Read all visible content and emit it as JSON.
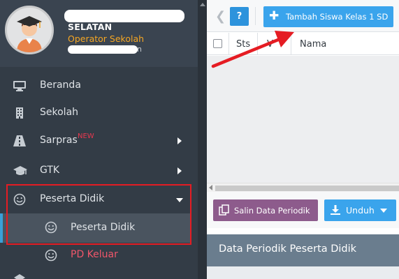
{
  "sidebar": {
    "user": {
      "school": "SELATAN",
      "role": "Operator Sekolah",
      "suffix": "n"
    },
    "menu": [
      {
        "label": "Beranda",
        "icon": "monitor-icon"
      },
      {
        "label": "Sekolah",
        "icon": "building-icon"
      },
      {
        "label": "Sarpras",
        "badge": "NEW",
        "icon": "road-icon"
      },
      {
        "label": "GTK",
        "icon": "graduation-cap-icon"
      },
      {
        "label": "Peserta Didik",
        "icon": "smile-icon"
      }
    ],
    "submenu": [
      {
        "label": "Peserta Didik",
        "icon": "smile-icon"
      },
      {
        "label": "PD Keluar",
        "icon": "smile-icon"
      }
    ]
  },
  "toolbar": {
    "help_label": "?",
    "add_label": "Tambah Siswa Kelas 1 SD"
  },
  "grid": {
    "columns": [
      "Sts",
      "V",
      "Nama"
    ]
  },
  "actions": {
    "salin_label": "Salin Data Periodik",
    "unduh_label": "Unduh"
  },
  "section": {
    "title": "Data Periodik Peserta Didik"
  },
  "colors": {
    "sidebar_bg": "#333c46",
    "accent_blue": "#3aa4ec",
    "salin_purple": "#8d5b8c",
    "highlight_red": "#e51c23",
    "pd_keluar_red": "#f0566a",
    "role_orange": "#f5a623"
  }
}
